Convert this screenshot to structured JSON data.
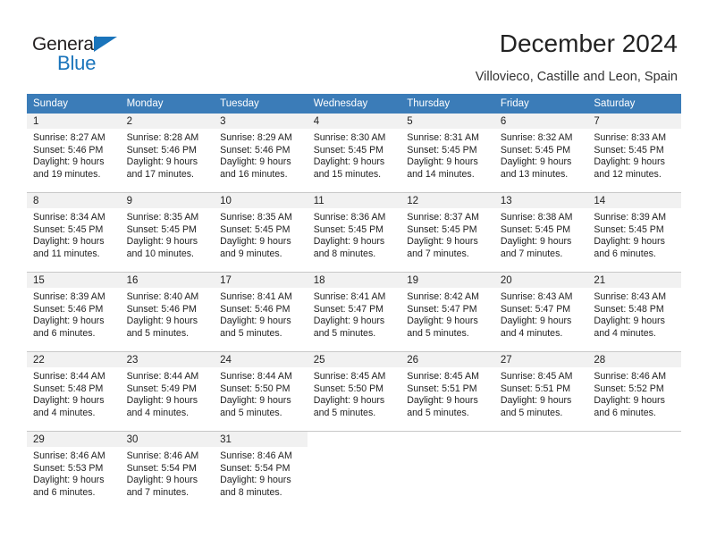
{
  "logo": {
    "word1": "General",
    "word2": "Blue",
    "triangle_icon": "triangle-icon",
    "brand_color": "#1a74bb"
  },
  "header": {
    "title": "December 2024",
    "subtitle": "Villovieco, Castille and Leon, Spain"
  },
  "calendar": {
    "header_bg": "#3b7cb8",
    "daynum_bg": "#f1f1f1",
    "weekday_headers": [
      "Sunday",
      "Monday",
      "Tuesday",
      "Wednesday",
      "Thursday",
      "Friday",
      "Saturday"
    ],
    "weeks": [
      [
        {
          "day": "1",
          "sunrise": "Sunrise: 8:27 AM",
          "sunset": "Sunset: 5:46 PM",
          "daylight1": "Daylight: 9 hours",
          "daylight2": "and 19 minutes."
        },
        {
          "day": "2",
          "sunrise": "Sunrise: 8:28 AM",
          "sunset": "Sunset: 5:46 PM",
          "daylight1": "Daylight: 9 hours",
          "daylight2": "and 17 minutes."
        },
        {
          "day": "3",
          "sunrise": "Sunrise: 8:29 AM",
          "sunset": "Sunset: 5:46 PM",
          "daylight1": "Daylight: 9 hours",
          "daylight2": "and 16 minutes."
        },
        {
          "day": "4",
          "sunrise": "Sunrise: 8:30 AM",
          "sunset": "Sunset: 5:45 PM",
          "daylight1": "Daylight: 9 hours",
          "daylight2": "and 15 minutes."
        },
        {
          "day": "5",
          "sunrise": "Sunrise: 8:31 AM",
          "sunset": "Sunset: 5:45 PM",
          "daylight1": "Daylight: 9 hours",
          "daylight2": "and 14 minutes."
        },
        {
          "day": "6",
          "sunrise": "Sunrise: 8:32 AM",
          "sunset": "Sunset: 5:45 PM",
          "daylight1": "Daylight: 9 hours",
          "daylight2": "and 13 minutes."
        },
        {
          "day": "7",
          "sunrise": "Sunrise: 8:33 AM",
          "sunset": "Sunset: 5:45 PM",
          "daylight1": "Daylight: 9 hours",
          "daylight2": "and 12 minutes."
        }
      ],
      [
        {
          "day": "8",
          "sunrise": "Sunrise: 8:34 AM",
          "sunset": "Sunset: 5:45 PM",
          "daylight1": "Daylight: 9 hours",
          "daylight2": "and 11 minutes."
        },
        {
          "day": "9",
          "sunrise": "Sunrise: 8:35 AM",
          "sunset": "Sunset: 5:45 PM",
          "daylight1": "Daylight: 9 hours",
          "daylight2": "and 10 minutes."
        },
        {
          "day": "10",
          "sunrise": "Sunrise: 8:35 AM",
          "sunset": "Sunset: 5:45 PM",
          "daylight1": "Daylight: 9 hours",
          "daylight2": "and 9 minutes."
        },
        {
          "day": "11",
          "sunrise": "Sunrise: 8:36 AM",
          "sunset": "Sunset: 5:45 PM",
          "daylight1": "Daylight: 9 hours",
          "daylight2": "and 8 minutes."
        },
        {
          "day": "12",
          "sunrise": "Sunrise: 8:37 AM",
          "sunset": "Sunset: 5:45 PM",
          "daylight1": "Daylight: 9 hours",
          "daylight2": "and 7 minutes."
        },
        {
          "day": "13",
          "sunrise": "Sunrise: 8:38 AM",
          "sunset": "Sunset: 5:45 PM",
          "daylight1": "Daylight: 9 hours",
          "daylight2": "and 7 minutes."
        },
        {
          "day": "14",
          "sunrise": "Sunrise: 8:39 AM",
          "sunset": "Sunset: 5:45 PM",
          "daylight1": "Daylight: 9 hours",
          "daylight2": "and 6 minutes."
        }
      ],
      [
        {
          "day": "15",
          "sunrise": "Sunrise: 8:39 AM",
          "sunset": "Sunset: 5:46 PM",
          "daylight1": "Daylight: 9 hours",
          "daylight2": "and 6 minutes."
        },
        {
          "day": "16",
          "sunrise": "Sunrise: 8:40 AM",
          "sunset": "Sunset: 5:46 PM",
          "daylight1": "Daylight: 9 hours",
          "daylight2": "and 5 minutes."
        },
        {
          "day": "17",
          "sunrise": "Sunrise: 8:41 AM",
          "sunset": "Sunset: 5:46 PM",
          "daylight1": "Daylight: 9 hours",
          "daylight2": "and 5 minutes."
        },
        {
          "day": "18",
          "sunrise": "Sunrise: 8:41 AM",
          "sunset": "Sunset: 5:47 PM",
          "daylight1": "Daylight: 9 hours",
          "daylight2": "and 5 minutes."
        },
        {
          "day": "19",
          "sunrise": "Sunrise: 8:42 AM",
          "sunset": "Sunset: 5:47 PM",
          "daylight1": "Daylight: 9 hours",
          "daylight2": "and 5 minutes."
        },
        {
          "day": "20",
          "sunrise": "Sunrise: 8:43 AM",
          "sunset": "Sunset: 5:47 PM",
          "daylight1": "Daylight: 9 hours",
          "daylight2": "and 4 minutes."
        },
        {
          "day": "21",
          "sunrise": "Sunrise: 8:43 AM",
          "sunset": "Sunset: 5:48 PM",
          "daylight1": "Daylight: 9 hours",
          "daylight2": "and 4 minutes."
        }
      ],
      [
        {
          "day": "22",
          "sunrise": "Sunrise: 8:44 AM",
          "sunset": "Sunset: 5:48 PM",
          "daylight1": "Daylight: 9 hours",
          "daylight2": "and 4 minutes."
        },
        {
          "day": "23",
          "sunrise": "Sunrise: 8:44 AM",
          "sunset": "Sunset: 5:49 PM",
          "daylight1": "Daylight: 9 hours",
          "daylight2": "and 4 minutes."
        },
        {
          "day": "24",
          "sunrise": "Sunrise: 8:44 AM",
          "sunset": "Sunset: 5:50 PM",
          "daylight1": "Daylight: 9 hours",
          "daylight2": "and 5 minutes."
        },
        {
          "day": "25",
          "sunrise": "Sunrise: 8:45 AM",
          "sunset": "Sunset: 5:50 PM",
          "daylight1": "Daylight: 9 hours",
          "daylight2": "and 5 minutes."
        },
        {
          "day": "26",
          "sunrise": "Sunrise: 8:45 AM",
          "sunset": "Sunset: 5:51 PM",
          "daylight1": "Daylight: 9 hours",
          "daylight2": "and 5 minutes."
        },
        {
          "day": "27",
          "sunrise": "Sunrise: 8:45 AM",
          "sunset": "Sunset: 5:51 PM",
          "daylight1": "Daylight: 9 hours",
          "daylight2": "and 5 minutes."
        },
        {
          "day": "28",
          "sunrise": "Sunrise: 8:46 AM",
          "sunset": "Sunset: 5:52 PM",
          "daylight1": "Daylight: 9 hours",
          "daylight2": "and 6 minutes."
        }
      ],
      [
        {
          "day": "29",
          "sunrise": "Sunrise: 8:46 AM",
          "sunset": "Sunset: 5:53 PM",
          "daylight1": "Daylight: 9 hours",
          "daylight2": "and 6 minutes."
        },
        {
          "day": "30",
          "sunrise": "Sunrise: 8:46 AM",
          "sunset": "Sunset: 5:54 PM",
          "daylight1": "Daylight: 9 hours",
          "daylight2": "and 7 minutes."
        },
        {
          "day": "31",
          "sunrise": "Sunrise: 8:46 AM",
          "sunset": "Sunset: 5:54 PM",
          "daylight1": "Daylight: 9 hours",
          "daylight2": "and 8 minutes."
        },
        {
          "day": "",
          "sunrise": "",
          "sunset": "",
          "daylight1": "",
          "daylight2": ""
        },
        {
          "day": "",
          "sunrise": "",
          "sunset": "",
          "daylight1": "",
          "daylight2": ""
        },
        {
          "day": "",
          "sunrise": "",
          "sunset": "",
          "daylight1": "",
          "daylight2": ""
        },
        {
          "day": "",
          "sunrise": "",
          "sunset": "",
          "daylight1": "",
          "daylight2": ""
        }
      ]
    ]
  }
}
